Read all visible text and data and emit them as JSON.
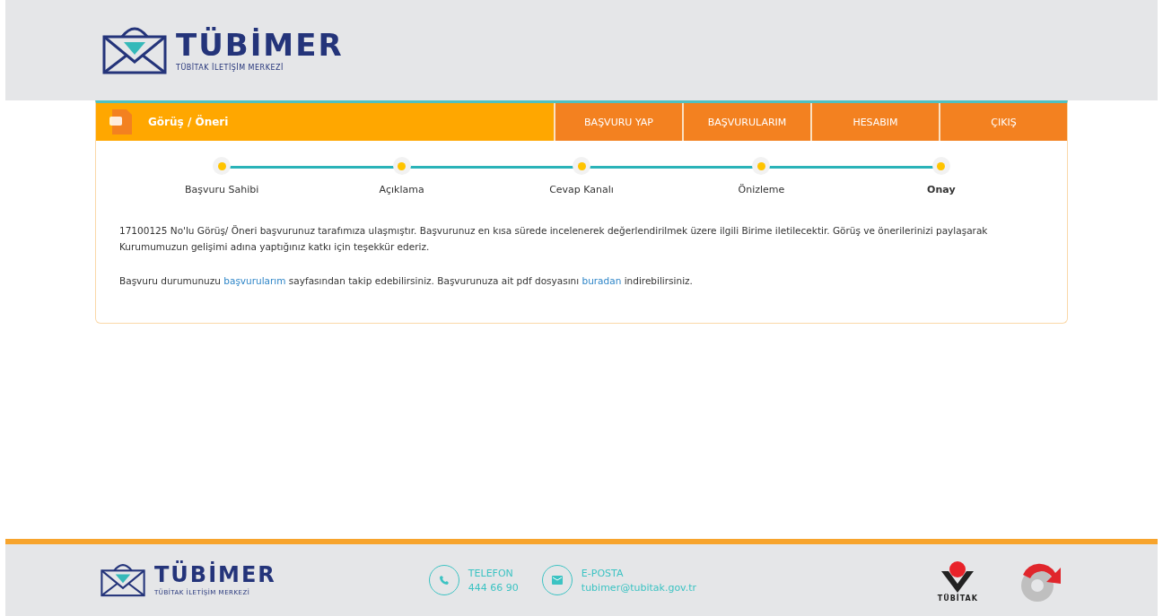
{
  "header": {
    "logo": {
      "name": "TÜBİMER",
      "tagline": "TÜBİTAK İLETİŞİM MERKEZİ"
    }
  },
  "panel": {
    "title": "Görüş / Öneri",
    "menu": [
      {
        "label": "BAŞVURU YAP"
      },
      {
        "label": "BAŞVURULARIM"
      },
      {
        "label": "HESABIM"
      },
      {
        "label": "ÇIKIŞ"
      }
    ],
    "steps": [
      {
        "label": "Başvuru Sahibi",
        "selected": false
      },
      {
        "label": "Açıklama",
        "selected": false
      },
      {
        "label": "Cevap Kanalı",
        "selected": false
      },
      {
        "label": "Önizleme",
        "selected": false
      },
      {
        "label": "Onay",
        "selected": true
      }
    ],
    "paragraphs": [
      {
        "parts": [
          {
            "kind": "text",
            "text": "17100125 No'lu Görüş/ Öneri başvurunuz tarafımıza ulaşmıştır. Başvurunuz en kısa sürede incelenerek değerlendirilmek üzere ilgili Birime iletilecektir. Görüş ve önerilerinizi paylaşarak Kurumumuzun gelişimi adına yaptığınız katkı için teşekkür ederiz."
          }
        ]
      },
      {
        "parts": [
          {
            "kind": "text",
            "text": "Başvuru durumunuzu "
          },
          {
            "kind": "link",
            "text": "başvurularım"
          },
          {
            "kind": "text",
            "text": " sayfasından takip edebilirsiniz. Başvurunuza ait pdf dosyasını "
          },
          {
            "kind": "link",
            "text": "buradan"
          },
          {
            "kind": "text",
            "text": " indirebilirsiniz."
          }
        ]
      }
    ]
  },
  "footer": {
    "logo": {
      "name": "TÜBİMER",
      "tagline": "TÜBİTAK İLETİŞİM MERKEZİ"
    },
    "contacts": [
      {
        "kind": "phone",
        "label": "TELEFON",
        "value": "444 66 90"
      },
      {
        "kind": "email",
        "label": "E-POSTA",
        "value": "tubimer@tubitak.gov.tr"
      }
    ],
    "partner": {
      "name": "TÜBİTAK"
    }
  }
}
